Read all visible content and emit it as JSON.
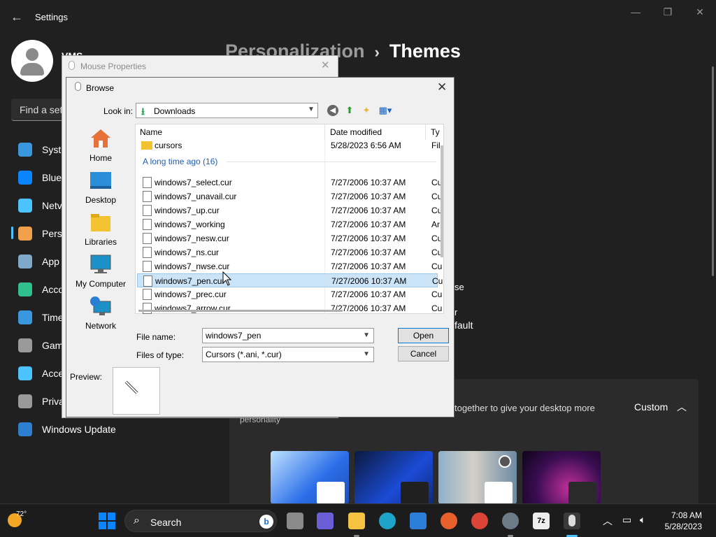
{
  "settings": {
    "title": "Settings",
    "user_name": "VMS",
    "search_placeholder": "Find a set",
    "breadcrumb_parent": "Personalization",
    "breadcrumb_current": "Themes",
    "nav": [
      {
        "label": "Syste",
        "color": "#3a96dd"
      },
      {
        "label": "Blue",
        "color": "#0a84ff"
      },
      {
        "label": "Netv",
        "color": "#4cc2ff"
      },
      {
        "label": "Pers",
        "color": "#f0a04b"
      },
      {
        "label": "App",
        "color": "#7fa8c9"
      },
      {
        "label": "Acco",
        "color": "#30c08e"
      },
      {
        "label": "Time",
        "color": "#3a96dd"
      },
      {
        "label": "Gam",
        "color": "#9a9a9a"
      },
      {
        "label": "Acces",
        "color": "#4cc2ff"
      },
      {
        "label": "Priva",
        "color": "#9a9a9a"
      },
      {
        "label": "Windows Update",
        "color": "#2f7fd1"
      }
    ],
    "fragments": [
      "se",
      "r",
      "fault"
    ],
    "theme_desc": "together to give your desktop more",
    "theme_desc2": "personality",
    "custom_label": "Custom"
  },
  "mouse_properties": {
    "title": "Mouse Properties"
  },
  "browse": {
    "title": "Browse",
    "look_in_label": "Look in:",
    "look_in_value": "Downloads",
    "places": [
      "Home",
      "Desktop",
      "Libraries",
      "My Computer",
      "Network"
    ],
    "columns": {
      "name": "Name",
      "date": "Date modified",
      "type": "Ty"
    },
    "folder": {
      "name": "cursors",
      "date": "5/28/2023 6:56 AM",
      "type": "Fil"
    },
    "group_label": "A long time ago (16)",
    "files": [
      {
        "name": "windows7_select.cur",
        "date": "7/27/2006 10:37 AM",
        "type": "Cu"
      },
      {
        "name": "windows7_unavail.cur",
        "date": "7/27/2006 10:37 AM",
        "type": "Cu"
      },
      {
        "name": "windows7_up.cur",
        "date": "7/27/2006 10:37 AM",
        "type": "Cu"
      },
      {
        "name": "windows7_working",
        "date": "7/27/2006 10:37 AM",
        "type": "Ar"
      },
      {
        "name": "windows7_nesw.cur",
        "date": "7/27/2006 10:37 AM",
        "type": "Cu"
      },
      {
        "name": "windows7_ns.cur",
        "date": "7/27/2006 10:37 AM",
        "type": "Cu"
      },
      {
        "name": "windows7_nwse.cur",
        "date": "7/27/2006 10:37 AM",
        "type": "Cu"
      },
      {
        "name": "windows7_pen.cur",
        "date": "7/27/2006 10:37 AM",
        "type": "Cu"
      },
      {
        "name": "windows7_prec.cur",
        "date": "7/27/2006 10:37 AM",
        "type": "Cu"
      },
      {
        "name": "windows7_arrow.cur",
        "date": "7/27/2006 10:37 AM",
        "type": "Cu"
      }
    ],
    "file_name_label": "File name:",
    "file_name_value": "windows7_pen",
    "file_type_label": "Files of type:",
    "file_type_value": "Cursors (*.ani, *.cur)",
    "open_label": "Open",
    "cancel_label": "Cancel",
    "preview_label": "Preview:"
  },
  "taskbar": {
    "temperature": "72°",
    "search_label": "Search",
    "time": "7:08 AM",
    "date": "5/28/2023"
  }
}
